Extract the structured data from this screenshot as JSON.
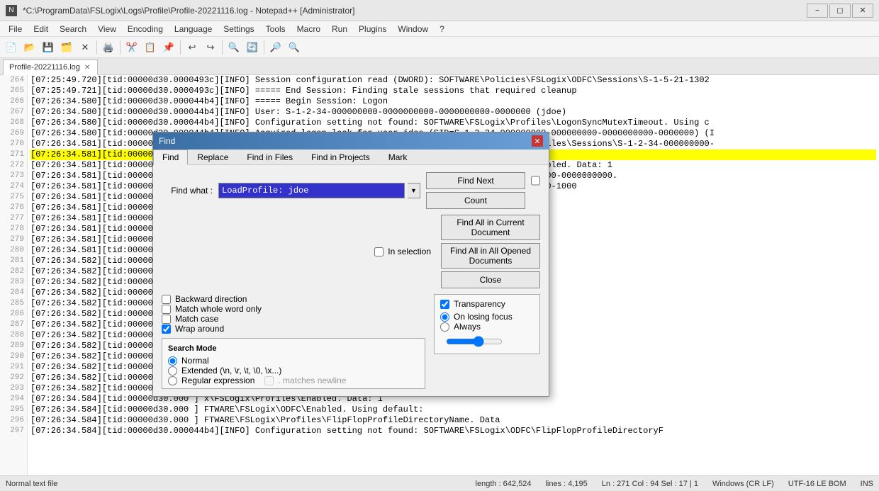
{
  "titlebar": {
    "title": "*C:\\ProgramData\\FSLogix\\Logs\\Profile\\Profile-20221116.log - Notepad++ [Administrator]",
    "controls": [
      "minimize",
      "restore",
      "close"
    ]
  },
  "menubar": {
    "items": [
      "File",
      "Edit",
      "Search",
      "View",
      "Encoding",
      "Language",
      "Settings",
      "Tools",
      "Macro",
      "Run",
      "Plugins",
      "Window",
      "?"
    ]
  },
  "tabs": [
    {
      "label": "Profile-20221116.log",
      "active": true
    }
  ],
  "editor": {
    "lines": [
      {
        "num": "264",
        "text": "[07:25:49.720][tid:00000d30.0000493c][INFO]          Session configuration read (DWORD): SOFTWARE\\Policies\\FSLogix\\ODFC\\Sessions\\S-1-5-21-1302"
      },
      {
        "num": "265",
        "text": "[07:25:49.721][tid:00000d30.0000493c][INFO]          ===== End Session: Finding stale sessions that required cleanup"
      },
      {
        "num": "266",
        "text": "[07:26:34.580][tid:00000d30.000044b4][INFO]          ===== Begin Session: Logon"
      },
      {
        "num": "267",
        "text": "[07:26:34.580][tid:00000d30.000044b4][INFO]            User: S-1-2-34-000000000-0000000000-0000000000-0000000 (jdoe)"
      },
      {
        "num": "268",
        "text": "[07:26:34.580][tid:00000d30.000044b4][INFO]            Configuration setting not found: SOFTWARE\\FSLogix\\Profiles\\LogonSyncMutexTimeout.  Using c"
      },
      {
        "num": "269",
        "text": "[07:26:34.580][tid:00000d30.000044b4][INFO]            Acquired logon lock for user jdoe (SID=S-1-2-34-000000000-000000000-0000000000-0000000) (I"
      },
      {
        "num": "270",
        "text": "[07:26:34.581][tid:00000d30.000044b4][INFO]            Session configuration read (DWORD): SOFTWARE\\FSLogix\\Profiles\\Sessions\\S-1-2-34-000000000-"
      },
      {
        "num": "271",
        "text": "[07:26:34.581][tid:00000d30.000044b4][INFO]          ===== Begin Session:  LoadProfile: jdoe",
        "highlight": "yellow"
      },
      {
        "num": "272",
        "text": "[07:26:34.581][tid:00000d30.000044b4][INFO]            Configuration Read (DWORD): SOFTWARE\\FSLogix\\Profiles\\Enabled.  Data: 1"
      },
      {
        "num": "273",
        "text": "[07:26:34.581][tid:00000d30.000044b4][INFO]            User: jdoe. SID: S-1-2-34-0000000000-00000000000-0000000000-0000000000."
      },
      {
        "num": "274",
        "text": "[07:26:34.581][tid:00000d30.000044b4][INFO]            Include group SID: S-1-5-21-1302457863-586979295-747715000-1000"
      },
      {
        "num": "275",
        "text": "[07:26:34.581][tid:00000d30.000  ]                                                                  863-586979295-747715000-1001"
      },
      {
        "num": "276",
        "text": "[07:26:34.581][tid:00000d30.000  ]                                                                  ap"
      },
      {
        "num": "277",
        "text": "[07:26:34.581][tid:00000d30.000  ]                                                                  FTWARE\\FSLogix\\Profiles\\IgnoreNonWVD.  Using default:"
      },
      {
        "num": "278",
        "text": "[07:26:34.581][tid:00000d30.000  ]                                                                  FTWARE\\FSLogix\\Profiles\\AccessNetworkAsComputerObject."
      },
      {
        "num": "279",
        "text": "[07:26:34.581][tid:00000d30.000  ]                                                                  RE\\FSLogix\\Profiles\\AttachVHDSDDL.  Data: O:%sid&D:P(I"
      },
      {
        "num": "280",
        "text": "[07:26:34.581][tid:00000d30.000  ]                                                                  FTWARE\\FSLogix\\Profiles\\AttachVHDSDDL.  Using dei"
      },
      {
        "num": "281",
        "text": "[07:26:34.582][tid:00000d30.000  ]                                                                  FTWARE\\FSLogix\\Profiles\\CcdUnregisterTimeout.  Using c"
      },
      {
        "num": "282",
        "text": "[07:26:34.582][tid:00000d30.000  ]                                                                  FTWARE\\FSLogix\\Profiles\\CcdUnregisterTimeout.  Using c"
      },
      {
        "num": "283",
        "text": "[07:26:34.582][tid:00000d30.000  ]                                                                  FTWARE\\FSLogix\\Profiles\\CCDMaxCacheSizeInMbs.  Using c"
      },
      {
        "num": "284",
        "text": "[07:26:34.582][tid:00000d30.000  ]                                                                  FTWARE\\Policies\\FSLogix\\ODFC\\CCDMaxCacheSizeInMbs.  Us"
      },
      {
        "num": "285",
        "text": "[07:26:34.582][tid:00000d30.000  ]                                                                  FSLogix\\Apps\\CleanupInvalidSessions.  Data: 1"
      },
      {
        "num": "286",
        "text": "[07:26:34.582][tid:00000d30.000  ]                                                                  FTWARE\\FSLogix\\Profiles\\ClearCacheOnLogoff.  Using de"
      },
      {
        "num": "287",
        "text": "[07:26:34.582][tid:00000d30.000  ]                                                                  FTWARE\\FSLogix\\Profiles\\ClearCacheOnLogoff.  Usin"
      },
      {
        "num": "288",
        "text": "[07:26:34.582][tid:00000d30.000  ]                                                                  FTWARE\\FSLogix\\Profiles\\ClearCacheOnForcedUnregister."
      },
      {
        "num": "289",
        "text": "[07:26:34.582][tid:00000d30.000  ]                                                                  FTWARE\\FSLogix\\Profiles\\ClearCacheOnForcedUnregis"
      },
      {
        "num": "290",
        "text": "[07:26:34.582][tid:00000d30.000  ]                                                                  FTWARE\\ODFC\\ClearCacheOnForcedUnregis"
      },
      {
        "num": "291",
        "text": "[07:26:34.582][tid:00000d30.000  ]                                                                  x\\FSLogix\\Profiles\\DeleteLocalProfileWhenVHDShouldAppl"
      },
      {
        "num": "292",
        "text": "[07:26:34.582][tid:00000d30.000  ]                                                                  FTWARE\\FSLogix\\Profiles\\DiffDiskParentFolderPath.  Us"
      },
      {
        "num": "293",
        "text": "[07:26:34.582][tid:00000d30.000  ]                                                                  FTWARE\\FSLogix\\Profiles\\DiffDiskParentFolderPath."
      },
      {
        "num": "294",
        "text": "[07:26:34.584][tid:00000d30.000  ]                                                                  x\\FSLogix\\Profiles\\Enabled.  Data: 1"
      },
      {
        "num": "295",
        "text": "[07:26:34.584][tid:00000d30.000  ]                                                                  FTWARE\\FSLogix\\ODFC\\Enabled.  Using default:"
      },
      {
        "num": "296",
        "text": "[07:26:34.584][tid:00000d30.000  ]                                                                  FTWARE\\FSLogix\\Profiles\\FlipFlopProfileDirectoryName.  Data"
      },
      {
        "num": "297",
        "text": "[07:26:34.584][tid:00000d30.000044b4][INFO]              Configuration setting not found: SOFTWARE\\FSLogix\\ODFC\\FlipFlopProfileDirectoryF"
      }
    ]
  },
  "find_dialog": {
    "title": "Find",
    "tabs": [
      "Find",
      "Replace",
      "Find in Files",
      "Find in Projects",
      "Mark"
    ],
    "find_what_label": "Find what :",
    "find_what_value": "LoadProfile: jdoe",
    "find_next_btn": "Find Next",
    "count_btn": "Count",
    "find_all_current_btn": "Find All in Current\nDocument",
    "find_all_opened_btn": "Find All in All Opened\nDocuments",
    "close_btn": "Close",
    "in_selection_label": "In selection",
    "options": {
      "backward_direction": "Backward direction",
      "match_whole_word": "Match whole word only",
      "match_case": "Match case",
      "wrap_around": "Wrap around"
    },
    "search_mode": {
      "title": "Search Mode",
      "options": [
        "Normal",
        "Extended (\\n, \\r, \\t, \\0, \\x...)",
        "Regular expression"
      ],
      "matches_newline": ". matches newline"
    },
    "transparency": {
      "title": "Transparency",
      "options": [
        "On losing focus",
        "Always"
      ],
      "checked": true
    }
  },
  "statusbar": {
    "file_type": "Normal text file",
    "length": "length : 642,524",
    "lines": "lines : 4,195",
    "position": "Ln : 271   Col : 94   Sel : 17 | 1",
    "line_endings": "Windows (CR LF)",
    "encoding": "UTF-16 LE BOM",
    "insert_mode": "INS"
  }
}
